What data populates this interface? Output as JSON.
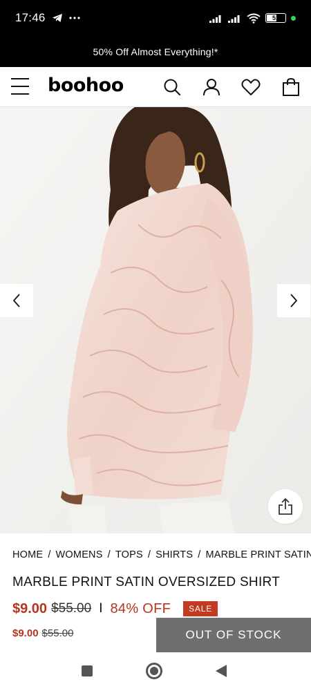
{
  "status_bar": {
    "time": "17:46",
    "battery": "51",
    "battery_level": 0.51
  },
  "promo": {
    "text": "50% Off Almost Everything!*"
  },
  "header": {
    "logo": "boohoo",
    "icons": [
      "menu-icon",
      "search-icon",
      "account-icon",
      "wishlist-heart-icon",
      "shopping-bag-icon"
    ]
  },
  "gallery": {
    "icons": [
      "chevron-left-icon",
      "chevron-right-icon",
      "share-icon"
    ]
  },
  "breadcrumb": {
    "items": [
      "HOME",
      "WOMENS",
      "TOPS",
      "SHIRTS",
      "MARBLE PRINT SATIN OVERSIZED SHIRT"
    ],
    "separator": "/"
  },
  "product": {
    "title": "MARBLE PRINT SATIN OVERSIZED SHIRT",
    "price": "$9.00",
    "original_price": "$55.00",
    "separator": "I",
    "discount": "84% OFF",
    "badge": "SALE"
  },
  "sticky": {
    "price": "$9.00",
    "original_price": "$55.00",
    "button_label": "OUT OF STOCK"
  },
  "colors": {
    "sale_red": "#b8341e",
    "out_of_stock_grey": "#6f6f6f",
    "promo_black": "#000000"
  }
}
